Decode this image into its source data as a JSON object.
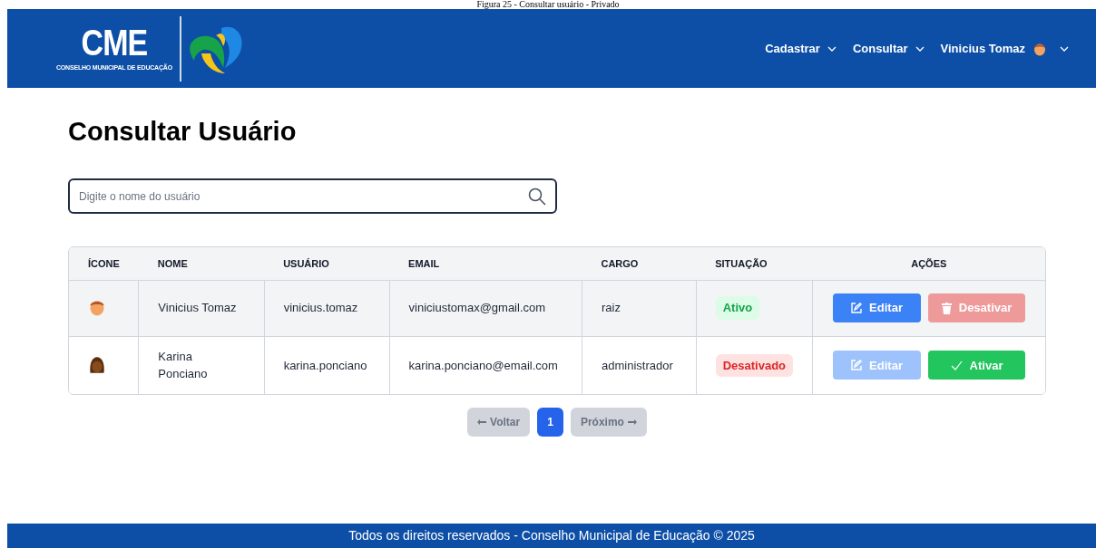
{
  "document_caption": "Figura 25 - Consultar usuário - Privado",
  "header": {
    "logo": {
      "acronym": "CME",
      "name": "CONSELHO MUNICIPAL DE EDUCAÇÃO"
    },
    "nav": [
      {
        "label": "Cadastrar",
        "kind": "menu"
      },
      {
        "label": "Consultar",
        "kind": "menu"
      },
      {
        "label": "Vinicius Tomaz",
        "kind": "user"
      }
    ]
  },
  "page_title": "Consultar Usuário",
  "search": {
    "placeholder": "Digite o nome do usuário"
  },
  "table": {
    "columns": [
      "ÍCONE",
      "NOME",
      "USUÁRIO",
      "EMAIL",
      "CARGO",
      "SITUAÇÃO",
      "AÇÕES"
    ],
    "rows": [
      {
        "highlighted": true,
        "avatar": {
          "kind": "male"
        },
        "name": "Vinicius Tomaz",
        "username": "vinicius.tomaz",
        "email": "viniciustomax@gmail.com",
        "role": "raiz",
        "status": {
          "kind": "active",
          "label": "Ativo"
        },
        "actions": [
          {
            "kind": "edit",
            "label": "Editar",
            "disabled": false
          },
          {
            "kind": "deactivate",
            "label": "Desativar",
            "disabled": true
          }
        ]
      },
      {
        "highlighted": false,
        "avatar": {
          "kind": "female"
        },
        "name": "Karina Ponciano",
        "username": "karina.ponciano",
        "email": "karina.ponciano@email.com",
        "role": "administrador",
        "status": {
          "kind": "inactive",
          "label": "Desativado"
        },
        "actions": [
          {
            "kind": "edit",
            "label": "Editar",
            "disabled": true
          },
          {
            "kind": "activate",
            "label": "Ativar",
            "disabled": false
          }
        ]
      }
    ]
  },
  "pagination": [
    {
      "kind": "prev",
      "label": "Voltar",
      "disabled": true,
      "selected": false
    },
    {
      "kind": "page",
      "label": "1",
      "selected": true
    },
    {
      "kind": "next",
      "label": "Próximo",
      "disabled": true,
      "selected": false
    }
  ],
  "footer": "Todos os direitos reservados - Conselho Municipal de Educação © 2025"
}
